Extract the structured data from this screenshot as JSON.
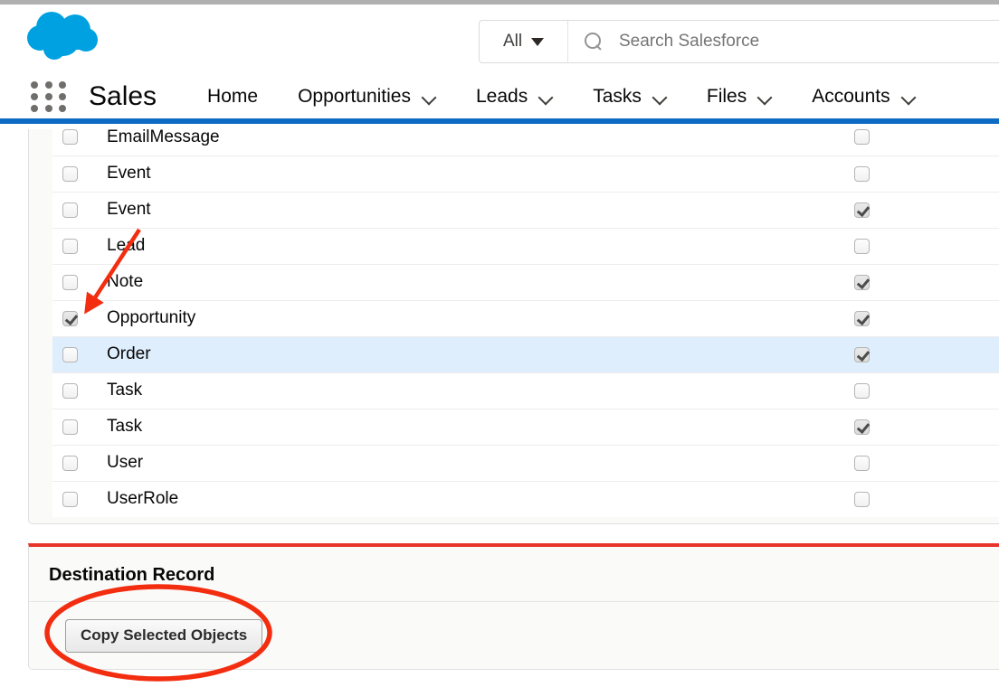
{
  "header": {
    "logo_icon": "salesforce-cloud-logo",
    "logo_color": "#00a1e0",
    "search": {
      "scope_label": "All",
      "scope_caret_icon": "caret-down-icon",
      "search_icon": "search-icon",
      "placeholder": "Search Salesforce",
      "value": ""
    }
  },
  "nav": {
    "waffle_icon": "app-launcher-icon",
    "app_name": "Sales",
    "accent_color": "#0d6bc4",
    "chevron_icon": "chevron-down-icon",
    "items": [
      {
        "label": "Home",
        "has_menu": false
      },
      {
        "label": "Opportunities",
        "has_menu": true
      },
      {
        "label": "Leads",
        "has_menu": true
      },
      {
        "label": "Tasks",
        "has_menu": true
      },
      {
        "label": "Files",
        "has_menu": true
      },
      {
        "label": "Accounts",
        "has_menu": true
      }
    ]
  },
  "objects_table": {
    "rows": [
      {
        "name": "EmailMessage",
        "left_checked": false,
        "right_checked": false,
        "highlighted": false
      },
      {
        "name": "Event",
        "left_checked": false,
        "right_checked": false,
        "highlighted": false
      },
      {
        "name": "Event",
        "left_checked": false,
        "right_checked": true,
        "highlighted": false
      },
      {
        "name": "Lead",
        "left_checked": false,
        "right_checked": false,
        "highlighted": false
      },
      {
        "name": "Note",
        "left_checked": false,
        "right_checked": true,
        "highlighted": false
      },
      {
        "name": "Opportunity",
        "left_checked": true,
        "right_checked": true,
        "highlighted": false
      },
      {
        "name": "Order",
        "left_checked": false,
        "right_checked": true,
        "highlighted": true
      },
      {
        "name": "Task",
        "left_checked": false,
        "right_checked": false,
        "highlighted": false
      },
      {
        "name": "Task",
        "left_checked": false,
        "right_checked": true,
        "highlighted": false
      },
      {
        "name": "User",
        "left_checked": false,
        "right_checked": false,
        "highlighted": false
      },
      {
        "name": "UserRole",
        "left_checked": false,
        "right_checked": false,
        "highlighted": false
      }
    ]
  },
  "destination": {
    "title": "Destination Record",
    "copy_button_label": "Copy Selected Objects"
  },
  "annotations": {
    "color": "#f22d10",
    "arrow_target": "opportunity-row-checkbox",
    "ellipse_target": "copy-selected-objects-button",
    "underline_target": "destination-record-panel-top"
  }
}
